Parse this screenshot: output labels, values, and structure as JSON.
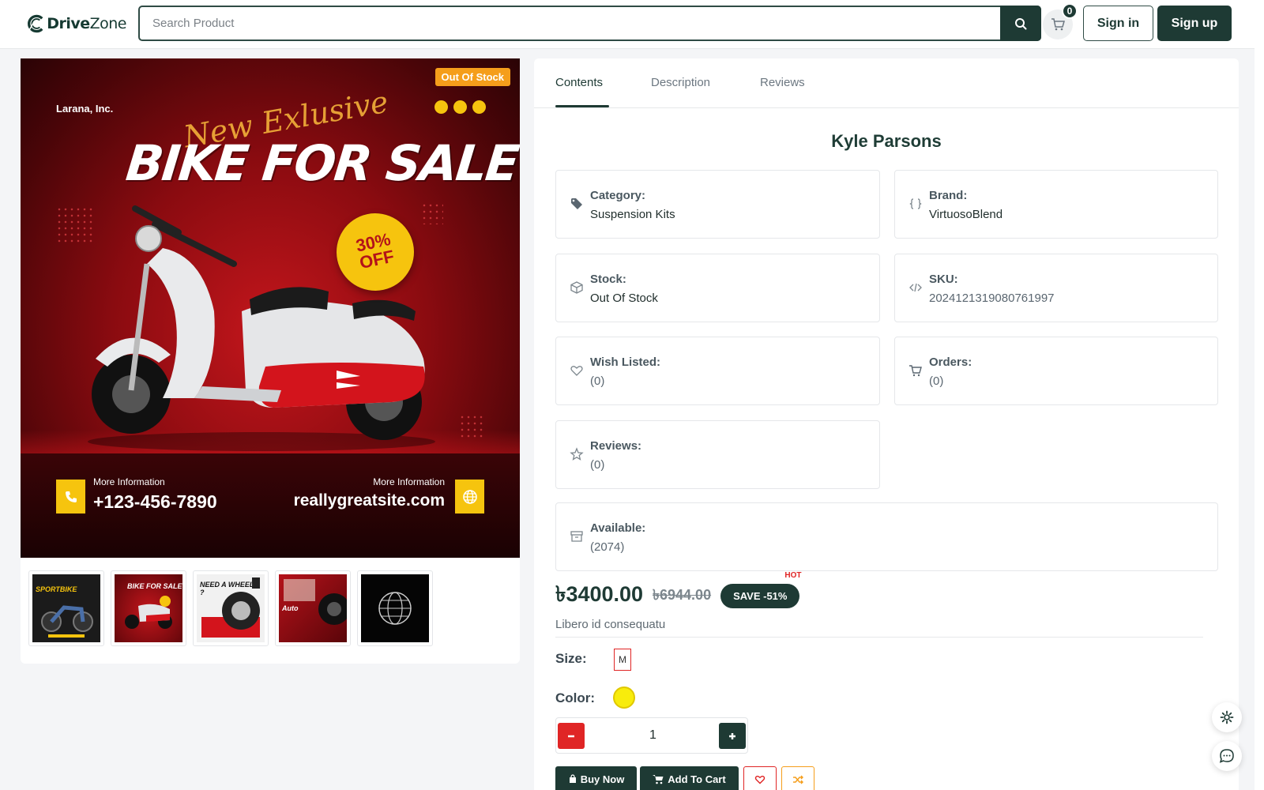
{
  "brand": {
    "name_bold": "Drive",
    "name_light": "Zone"
  },
  "search": {
    "placeholder": "Search Product"
  },
  "cart": {
    "count": "0"
  },
  "auth": {
    "signin": "Sign in",
    "signup": "Sign up"
  },
  "gallery": {
    "badge": "Out Of Stock",
    "banner": {
      "company": "Larana, Inc.",
      "script": "New Exlusive",
      "title": "BIKE FOR SALE",
      "offer_line1": "30%",
      "offer_line2": "OFF",
      "left_small": "More Information",
      "left_big": "+123-456-7890",
      "right_small": "More Information",
      "right_big": "reallygreatsite.com"
    },
    "thumbs": [
      {
        "label": "SPORTBIKE"
      },
      {
        "label": "BIKE FOR SALE"
      },
      {
        "label": "NEED A WHEELS ?"
      },
      {
        "label": "Auto"
      },
      {
        "label": ""
      }
    ]
  },
  "tabs": [
    {
      "label": "Contents",
      "active": true
    },
    {
      "label": "Description",
      "active": false
    },
    {
      "label": "Reviews",
      "active": false
    }
  ],
  "product": {
    "title": "Kyle Parsons",
    "info": {
      "category": {
        "label": "Category:",
        "value": "Suspension Kits"
      },
      "brand": {
        "label": "Brand:",
        "value": "VirtuosoBlend"
      },
      "stock": {
        "label": "Stock:",
        "value": "Out Of Stock"
      },
      "sku": {
        "label": "SKU:",
        "value": "2024121319080761997"
      },
      "wishlisted": {
        "label": "Wish Listed:",
        "value": "(0)"
      },
      "orders": {
        "label": "Orders:",
        "value": "(0)"
      },
      "reviews": {
        "label": "Reviews:",
        "value": "(0)"
      },
      "available": {
        "label": "Available:",
        "value": "(2074)"
      }
    },
    "price": "৳3400.00",
    "old_price": "৳6944.00",
    "save": "SAVE -51%",
    "hot": "HOT",
    "short_desc": "Libero id consequatu",
    "size_label": "Size:",
    "size": "M",
    "color_label": "Color:",
    "color_value": "#f8ec0c",
    "quantity": "1",
    "buy_now": "Buy Now",
    "add_to_cart": "Add To Cart"
  },
  "colors": {
    "primary": "#1e3a34",
    "danger": "#e02525",
    "warning": "#f59e1b"
  }
}
